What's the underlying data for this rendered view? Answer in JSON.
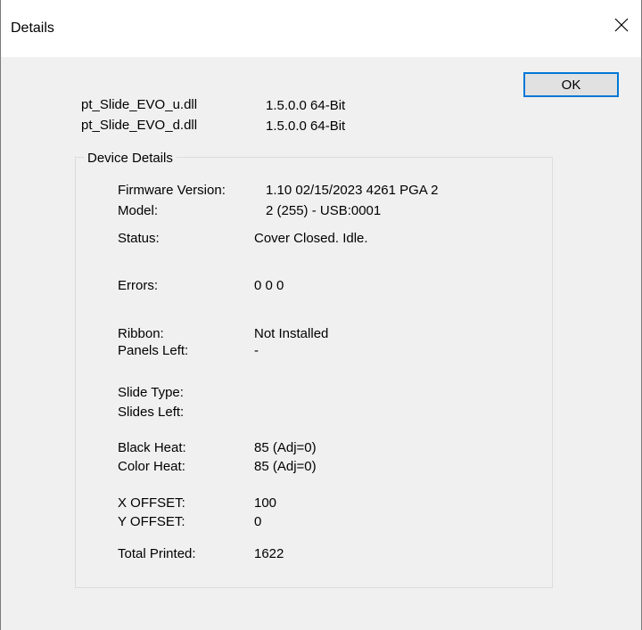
{
  "window": {
    "title": "Details",
    "close_glyph": "✕"
  },
  "buttons": {
    "ok_label": "OK"
  },
  "dlls": [
    {
      "name": "pt_Slide_EVO_u.dll",
      "version": "1.5.0.0  64-Bit"
    },
    {
      "name": "pt_Slide_EVO_d.dll",
      "version": "1.5.0.0  64-Bit"
    }
  ],
  "device_details": {
    "caption": "Device Details",
    "firmware_label": "Firmware Version:",
    "firmware_value": "1.10 02/15/2023  4261  PGA 2",
    "model_label": "Model:",
    "model_value": "2 (255) - USB:0001",
    "status_label": "Status:",
    "status_value": "Cover Closed. Idle.",
    "errors_label": "Errors:",
    "errors_value": "0 0 0",
    "ribbon_label": "Ribbon:",
    "ribbon_value": "Not Installed",
    "panels_left_label": "Panels Left:",
    "panels_left_value": "-",
    "slide_type_label": "Slide Type:",
    "slide_type_value": "",
    "slides_left_label": "Slides Left:",
    "slides_left_value": "",
    "black_heat_label": "Black Heat:",
    "black_heat_value": "85  (Adj=0)",
    "color_heat_label": "Color Heat:",
    "color_heat_value": "85  (Adj=0)",
    "x_offset_label": "X OFFSET:",
    "x_offset_value": "100",
    "y_offset_label": "Y OFFSET:",
    "y_offset_value": "0",
    "total_printed_label": "Total  Printed:",
    "total_printed_value": "1622"
  },
  "colors": {
    "dialog_bg": "#f0f0f0",
    "titlebar_bg": "#ffffff",
    "button_focus_border": "#0078d7",
    "button_bg": "#e1e1e1"
  }
}
